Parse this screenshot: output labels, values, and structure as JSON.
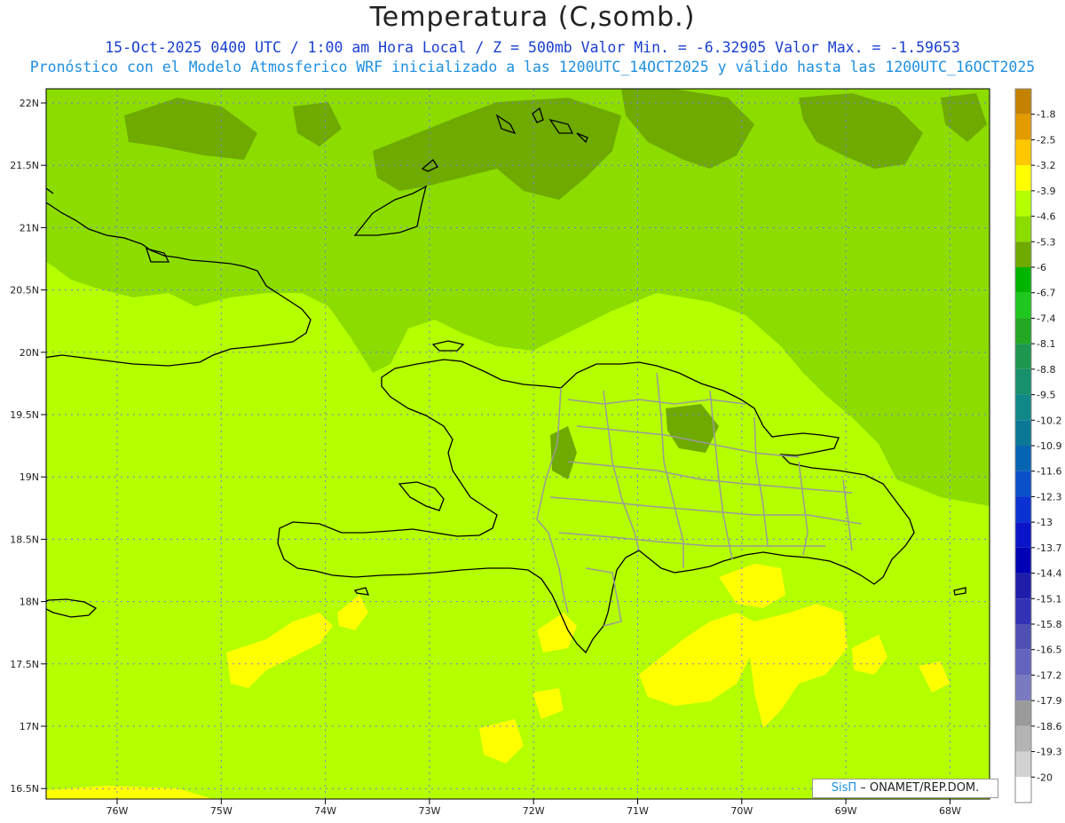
{
  "title": "Temperatura (C,somb.)",
  "subtitle_line1": "15-Oct-2025  0400 UTC / 1:00 am Hora Local / Z = 500mb  Valor Min. = -6.32905  Valor Max. = -1.59653",
  "subtitle_line2": "Pronóstico con el Modelo Atmosferico WRF inicializado a las 1200UTC_14OCT2025 y válido hasta las  1200UTC_16OCT2025",
  "credit": {
    "brand": "SisΠ",
    "text": " – ONAMET/REP.DOM."
  },
  "lat_labels": [
    "22N",
    "21.5N",
    "21N",
    "20.5N",
    "20N",
    "19.5N",
    "19N",
    "18.5N",
    "18N",
    "17.5N",
    "17N",
    "16.5N"
  ],
  "lon_labels": [
    "76W",
    "75W",
    "74W",
    "73W",
    "72W",
    "71W",
    "70W",
    "69W",
    "68W"
  ],
  "colorbar": {
    "labels": [
      "-1.8",
      "-2.5",
      "-3.2",
      "-3.9",
      "-4.6",
      "-5.3",
      "-6",
      "-6.7",
      "-7.4",
      "-8.1",
      "-8.8",
      "-9.5",
      "-10.2",
      "-10.9",
      "-11.6",
      "-12.3",
      "-13",
      "-13.7",
      "-14.4",
      "-15.1",
      "-15.8",
      "-16.5",
      "-17.2",
      "-17.9",
      "-18.6",
      "-19.3",
      "-20"
    ],
    "colors": [
      "#c58200",
      "#e49b00",
      "#ffc800",
      "#ffff00",
      "#b4ff00",
      "#8cdc00",
      "#6eaa00",
      "#00b400",
      "#1ec81e",
      "#22a822",
      "#1e9650",
      "#18906e",
      "#108888",
      "#0a7896",
      "#0664b4",
      "#0a50c8",
      "#0a32d2",
      "#0a14c8",
      "#0000b4",
      "#1e1eaa",
      "#3232b4",
      "#5050b4",
      "#6464be",
      "#7a7ac0",
      "#9a9a9a",
      "#b4b4b4",
      "#d2d2d2",
      "#ffffff"
    ]
  },
  "field_colors": {
    "warm": "#ffff00",
    "mid": "#b4ff00",
    "cool": "#8cdc00",
    "cold": "#6eaa00"
  }
}
